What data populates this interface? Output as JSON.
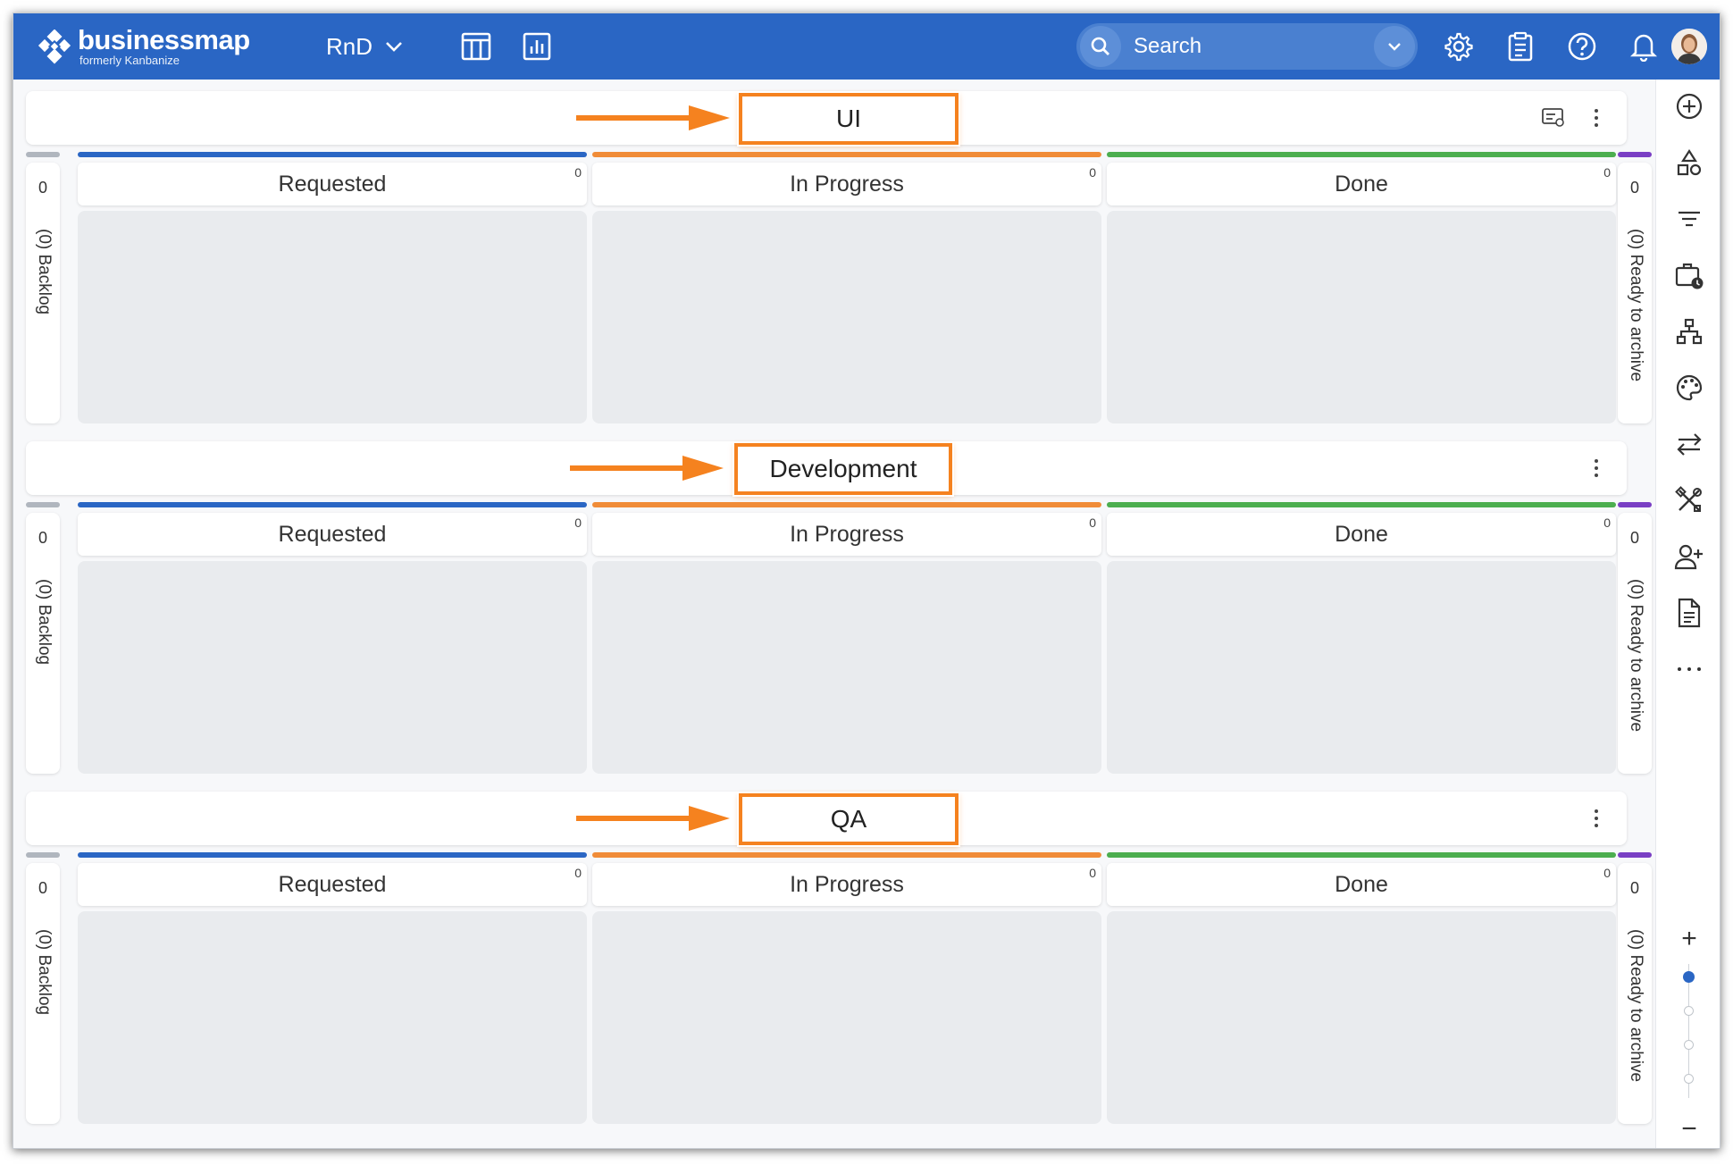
{
  "app": {
    "logo_name": "businessmap",
    "logo_sub": "formerly Kanbanize",
    "board_name": "RnD",
    "brand_color": "#2a66c4",
    "accent_color": "#f5821f"
  },
  "header": {
    "search_placeholder": "Search",
    "icons": [
      "grid-view-icon",
      "analytics-icon",
      "settings-icon",
      "clipboard-icon",
      "help-icon",
      "bell-icon",
      "avatar"
    ]
  },
  "columns": [
    {
      "label": "Requested",
      "count": "0",
      "color": "#2a66c4"
    },
    {
      "label": "In Progress",
      "count": "0",
      "color": "#f08c38"
    },
    {
      "label": "Done",
      "count": "0",
      "color": "#4cae4f"
    }
  ],
  "side_columns": {
    "left": {
      "count": "0",
      "label": "(0) Backlog",
      "color": "#b0b6be"
    },
    "right": {
      "count": "0",
      "label": "(0) Ready to archive",
      "color": "#7a3fc4"
    }
  },
  "lanes": [
    {
      "name": "UI"
    },
    {
      "name": "Development"
    },
    {
      "name": "QA"
    }
  ],
  "rail": {
    "icons": [
      "add-icon",
      "shapes-icon",
      "filter-icon",
      "briefcase-clock-icon",
      "hierarchy-icon",
      "palette-icon",
      "swap-icon",
      "tools-icon",
      "add-user-icon",
      "document-icon",
      "more-icon"
    ],
    "zoom": {
      "plus": "+",
      "minus": "−",
      "level": 1,
      "steps": 4
    }
  }
}
